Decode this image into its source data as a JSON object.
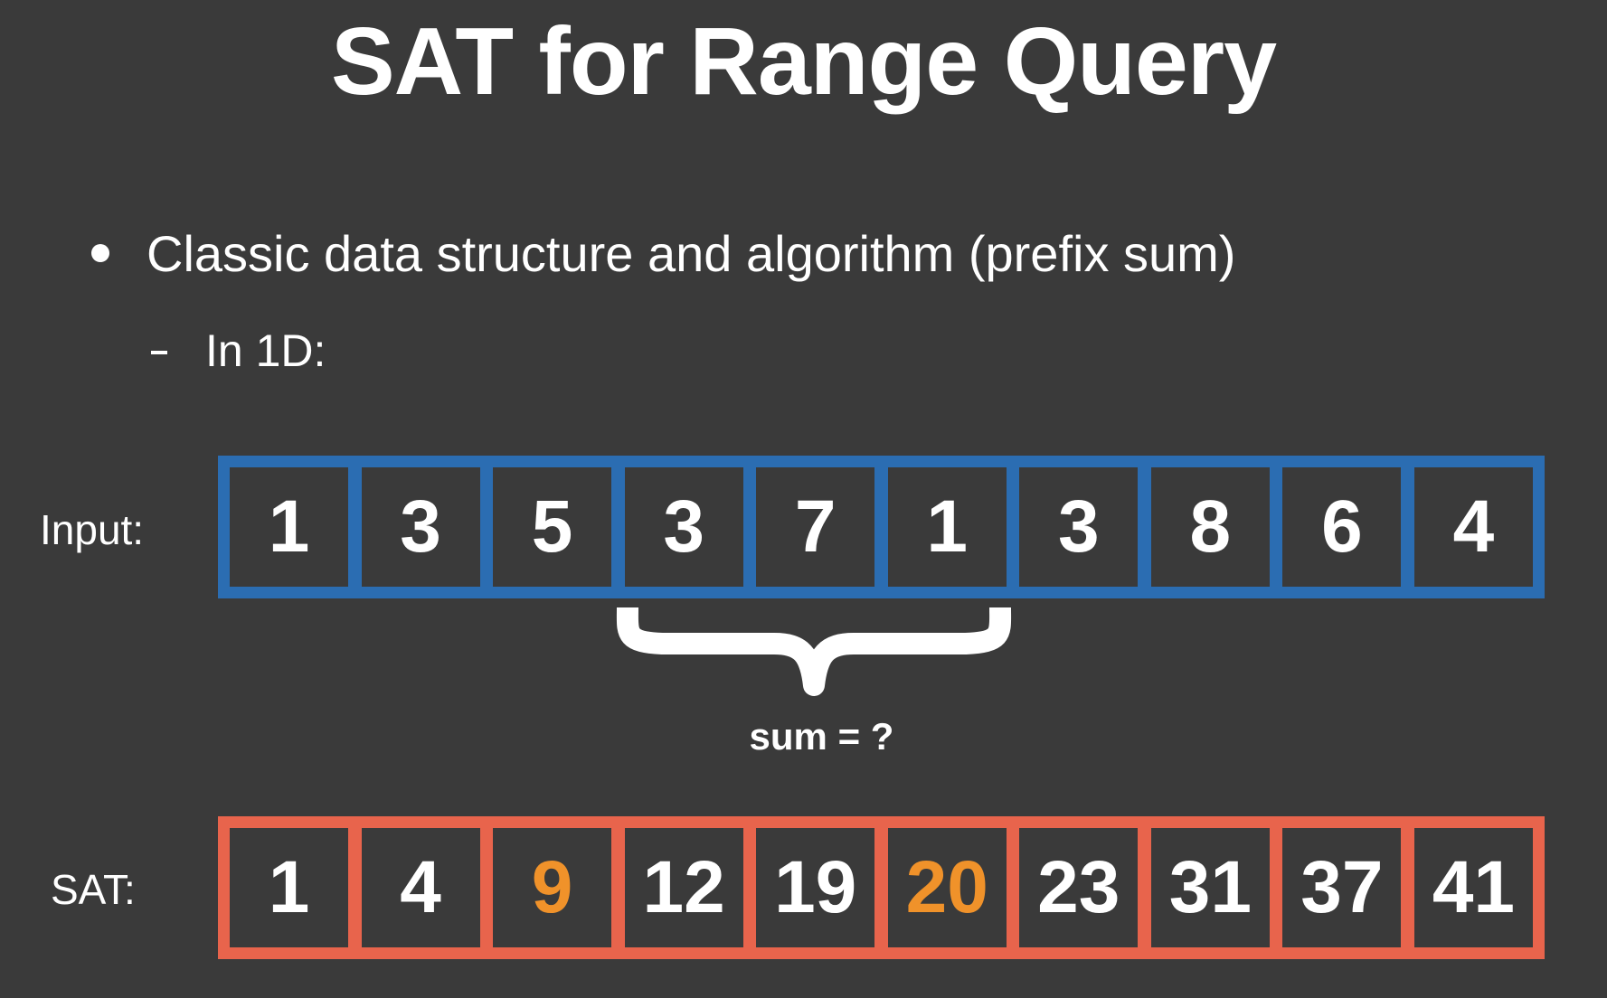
{
  "slide": {
    "title": "SAT for Range Query",
    "bullet": "Classic data structure and algorithm (prefix sum)",
    "sub_bullet": "In 1D:"
  },
  "input_row": {
    "label": "Input:",
    "values": [
      "1",
      "3",
      "5",
      "3",
      "7",
      "1",
      "3",
      "8",
      "6",
      "4"
    ],
    "border_color": "#2b6db2"
  },
  "brace": {
    "label": "sum = ?",
    "spans_cells": [
      3,
      5
    ]
  },
  "sat_row": {
    "label": "SAT:",
    "values": [
      "1",
      "4",
      "9",
      "12",
      "19",
      "20",
      "23",
      "31",
      "37",
      "41"
    ],
    "highlighted": [
      2,
      5
    ],
    "border_color": "#e8644c",
    "highlight_color": "#f0922a"
  },
  "colors": {
    "background": "#3a3a3a",
    "text": "#ffffff"
  }
}
